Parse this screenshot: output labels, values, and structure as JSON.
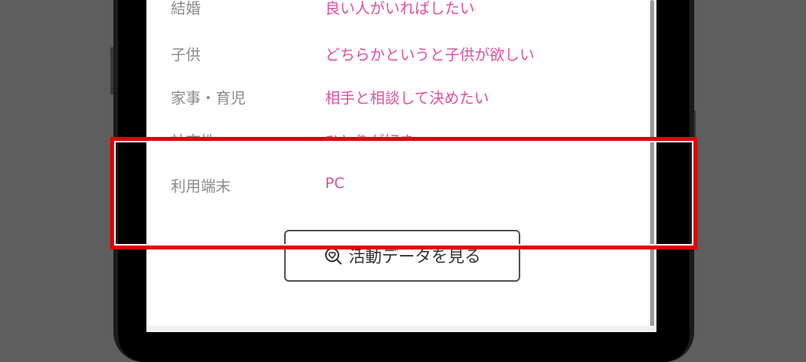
{
  "profile": {
    "rows": [
      {
        "label": "結婚",
        "value": "良い人がいればしたい"
      },
      {
        "label": "子供",
        "value": "どちらかというと子供が欲しい"
      },
      {
        "label": "家事・育児",
        "value": "相手と相談して決めたい"
      },
      {
        "label": "社交性",
        "value": "ひとりが好き"
      },
      {
        "label": "利用端末",
        "value": "PC"
      }
    ]
  },
  "actions": {
    "activity_button_label": "活動データを見る",
    "activity_icon": "heart-search-icon"
  },
  "colors": {
    "value_text": "#e04f9f",
    "label_text": "#8a8a8a",
    "highlight_border": "#e00000"
  }
}
